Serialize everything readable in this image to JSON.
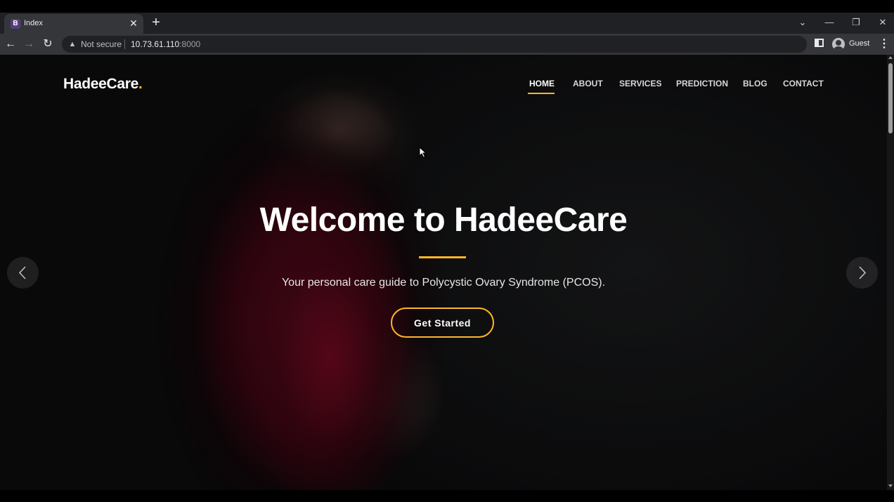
{
  "browser": {
    "tab": {
      "favicon_letter": "B",
      "title": "Index",
      "close": "✕"
    },
    "new_tab": "+",
    "omnibox": {
      "security_text": "Not secure",
      "host": "10.73.61.110",
      "port": ":8000"
    },
    "profile_label": "Guest",
    "icons": {
      "back": "back-arrow-icon",
      "forward": "forward-arrow-icon",
      "reload": "reload-icon",
      "warning": "warning-icon",
      "side_panel": "side-panel-icon",
      "menu": "three-dots-icon"
    }
  },
  "site": {
    "logo_text": "HadeeCare",
    "logo_dot": ".",
    "nav": [
      "HOME",
      "ABOUT",
      "SERVICES",
      "PREDICTION",
      "BLOG",
      "CONTACT"
    ],
    "active_nav": "HOME",
    "hero": {
      "title": "Welcome to HadeeCare",
      "subtitle": "Your personal care guide to Polycystic Ovary Syndrome (PCOS).",
      "cta_label": "Get Started"
    }
  },
  "colors": {
    "accent": "#ffb727",
    "chrome_dark": "#202124",
    "chrome_toolbar": "#35363a"
  }
}
